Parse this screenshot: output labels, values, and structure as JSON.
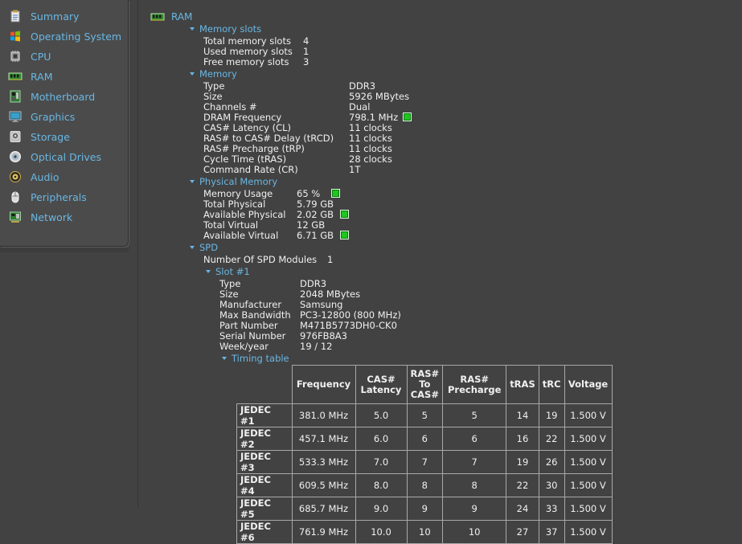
{
  "sidebar": {
    "items": [
      {
        "label": "Summary",
        "icon": "summary-icon"
      },
      {
        "label": "Operating System",
        "icon": "windows-logo-icon"
      },
      {
        "label": "CPU",
        "icon": "cpu-icon"
      },
      {
        "label": "RAM",
        "icon": "ram-icon"
      },
      {
        "label": "Motherboard",
        "icon": "motherboard-icon"
      },
      {
        "label": "Graphics",
        "icon": "monitor-icon"
      },
      {
        "label": "Storage",
        "icon": "hard-drive-icon"
      },
      {
        "label": "Optical Drives",
        "icon": "optical-disc-icon"
      },
      {
        "label": "Audio",
        "icon": "speaker-icon"
      },
      {
        "label": "Peripherals",
        "icon": "mouse-icon"
      },
      {
        "label": "Network",
        "icon": "network-icon"
      }
    ]
  },
  "main": {
    "title": "RAM",
    "memory_slots": {
      "label": "Memory slots",
      "rows": [
        {
          "k": "Total memory slots",
          "v": "4"
        },
        {
          "k": "Used memory slots",
          "v": "1"
        },
        {
          "k": "Free memory slots",
          "v": "3"
        }
      ]
    },
    "memory": {
      "label": "Memory",
      "rows": [
        {
          "k": "Type",
          "v": "DDR3"
        },
        {
          "k": "Size",
          "v": "5926 MBytes"
        },
        {
          "k": "Channels #",
          "v": "Dual"
        },
        {
          "k": "DRAM Frequency",
          "v": "798.1 MHz"
        },
        {
          "k": "CAS# Latency (CL)",
          "v": "11 clocks"
        },
        {
          "k": "RAS# to CAS# Delay (tRCD)",
          "v": "11 clocks"
        },
        {
          "k": "RAS# Precharge (tRP)",
          "v": "11 clocks"
        },
        {
          "k": "Cycle Time (tRAS)",
          "v": "28 clocks"
        },
        {
          "k": "Command Rate (CR)",
          "v": "1T"
        }
      ]
    },
    "physical_memory": {
      "label": "Physical Memory",
      "rows": [
        {
          "k": "Memory Usage",
          "v": "65 %"
        },
        {
          "k": "Total Physical",
          "v": "5.79 GB"
        },
        {
          "k": "Available Physical",
          "v": "2.02 GB"
        },
        {
          "k": "Total Virtual",
          "v": "12 GB"
        },
        {
          "k": "Available Virtual",
          "v": "6.71 GB"
        }
      ]
    },
    "spd": {
      "label": "SPD",
      "modules_k": "Number Of SPD Modules",
      "modules_v": "1",
      "slot": {
        "label": "Slot #1",
        "rows": [
          {
            "k": "Type",
            "v": "DDR3"
          },
          {
            "k": "Size",
            "v": "2048 MBytes"
          },
          {
            "k": "Manufacturer",
            "v": "Samsung"
          },
          {
            "k": "Max Bandwidth",
            "v": "PC3-12800 (800 MHz)"
          },
          {
            "k": "Part Number",
            "v": "M471B5773DH0-CK0"
          },
          {
            "k": "Serial Number",
            "v": "976FB8A3"
          },
          {
            "k": "Week/year",
            "v": "19 / 12"
          }
        ],
        "timing_label": "Timing table",
        "timing": {
          "headers": [
            "Frequency",
            "CAS#\nLatency",
            "RAS#\nTo\nCAS#",
            "RAS#\nPrecharge",
            "tRAS",
            "tRC",
            "Voltage"
          ],
          "rows": [
            {
              "name": "JEDEC #1",
              "cells": [
                "381.0 MHz",
                "5.0",
                "5",
                "5",
                "14",
                "19",
                "1.500 V"
              ]
            },
            {
              "name": "JEDEC #2",
              "cells": [
                "457.1 MHz",
                "6.0",
                "6",
                "6",
                "16",
                "22",
                "1.500 V"
              ]
            },
            {
              "name": "JEDEC #3",
              "cells": [
                "533.3 MHz",
                "7.0",
                "7",
                "7",
                "19",
                "26",
                "1.500 V"
              ]
            },
            {
              "name": "JEDEC #4",
              "cells": [
                "609.5 MHz",
                "8.0",
                "8",
                "8",
                "22",
                "30",
                "1.500 V"
              ]
            },
            {
              "name": "JEDEC #5",
              "cells": [
                "685.7 MHz",
                "9.0",
                "9",
                "9",
                "24",
                "33",
                "1.500 V"
              ]
            },
            {
              "name": "JEDEC #6",
              "cells": [
                "761.9 MHz",
                "10.0",
                "10",
                "10",
                "27",
                "37",
                "1.500 V"
              ]
            }
          ]
        }
      }
    }
  },
  "colors": {
    "background": "#424242",
    "accent": "#69b7e3",
    "indicator": "#1fc61f"
  }
}
